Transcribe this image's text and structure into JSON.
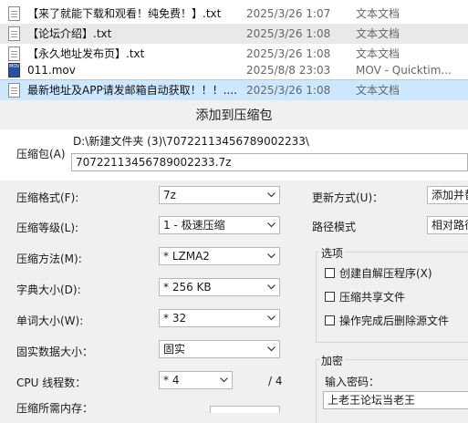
{
  "files": [
    {
      "name": "【来了就能下载和观看！纯免费！】.txt",
      "date": "2025/3/26 1:07",
      "type": "文本文档",
      "icon": "text-file-icon",
      "state": "normal"
    },
    {
      "name": "【论坛介绍】.txt",
      "date": "2025/3/26 1:08",
      "type": "文本文档",
      "icon": "text-file-icon",
      "state": "shaded"
    },
    {
      "name": "【永久地址发布页】.txt",
      "date": "2025/3/26 1:08",
      "type": "文本文档",
      "icon": "text-file-icon",
      "state": "normal"
    },
    {
      "name": "011.mov",
      "date": "2025/8/8 23:03",
      "type": "MOV - Quicktim...",
      "icon": "mov-file-icon",
      "icon_text": "MOV",
      "state": "normal"
    },
    {
      "name": "最新地址及APP请发邮箱自动获取！！！....",
      "date": "2025/3/26 1:08",
      "type": "文本文档",
      "icon": "text-file-icon",
      "state": "selected"
    }
  ],
  "dialog": {
    "title": "添加到压缩包",
    "archive_label": "压缩包(A)",
    "archive_path": "D:\\新建文件夹 (3)\\70722113456789002233\\",
    "archive_name": "70722113456789002233.7z",
    "format_label": "压缩格式(F):",
    "format_value": "7z",
    "level_label": "压缩等级(L):",
    "level_value": "1 - 极速压缩",
    "method_label": "压缩方法(M):",
    "method_value": "* LZMA2",
    "dict_label": "字典大小(D):",
    "dict_value": "* 256 KB",
    "word_label": "单词大小(W):",
    "word_value": "* 32",
    "solid_label": "固实数据大小：",
    "solid_value": "固实",
    "cpu_label": "CPU 线程数：",
    "cpu_value": "* 4",
    "cpu_total": "/ 4",
    "memory_label": "压缩所需内存：",
    "update_label": "更新方式(U)：",
    "update_value": "添加并替换文件",
    "pathmode_label": "路径模式",
    "pathmode_value": "相对路径",
    "options_title": "选项",
    "opt_sfx": "创建自解压程序(X)",
    "opt_shared": "压缩共享文件",
    "opt_delete": "操作完成后删除源文件",
    "encrypt_title": "加密",
    "password_label": "输入密码：",
    "password_value": "上老王论坛当老王"
  },
  "colors": {
    "selection": "#cce8ff",
    "selection_border": "#99d1ff",
    "dialog_bg": "#f0f0f0",
    "mov_icon": "#2b4f9c"
  }
}
